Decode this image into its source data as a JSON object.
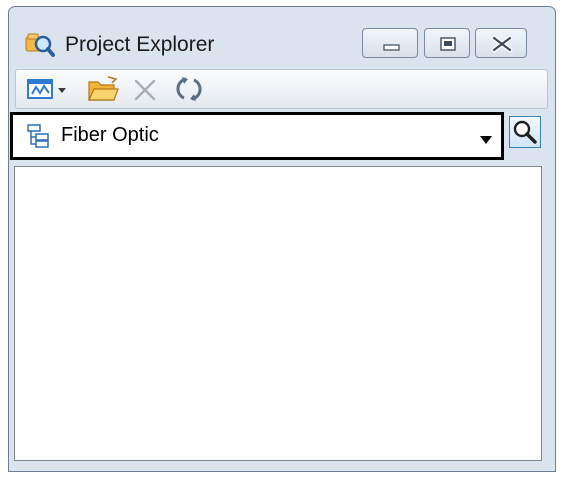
{
  "window": {
    "title": "Project Explorer",
    "controls": [
      "minimize",
      "restore",
      "close"
    ]
  },
  "toolbar": {
    "items": [
      {
        "icon": "link-dropdown-icon"
      },
      {
        "icon": "open-folder-icon"
      },
      {
        "icon": "delete-icon",
        "enabled": false
      },
      {
        "icon": "refresh-icon"
      }
    ]
  },
  "selector": {
    "selected": "Fiber Optic",
    "icon": "tree-structure-icon",
    "highlight_color": "#000000"
  },
  "search": {
    "icon": "magnifier-icon"
  },
  "colors": {
    "window_bg": "#dae3ee",
    "content_bg": "#ffffff"
  }
}
